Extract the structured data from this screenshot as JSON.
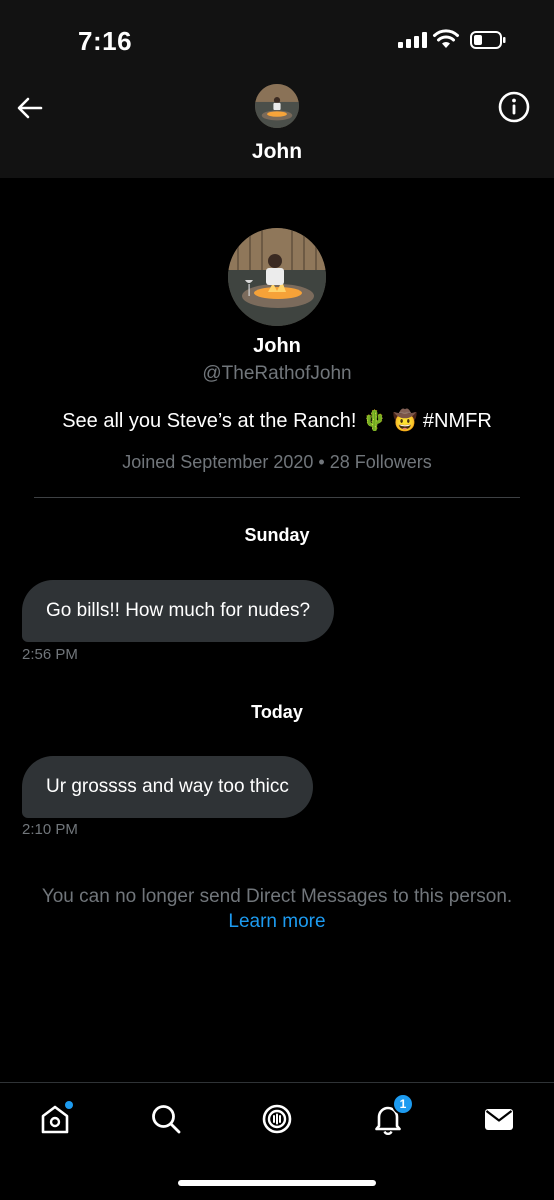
{
  "status_bar": {
    "time": "7:16"
  },
  "header": {
    "name": "John"
  },
  "profile": {
    "name": "John",
    "handle": "@TheRathofJohn",
    "bio": "See all you Steve’s at the Ranch! 🌵 🤠 #NMFR",
    "meta": "Joined September 2020 • 28 Followers"
  },
  "conversation": [
    {
      "day": "Sunday",
      "message": "Go bills!! How much for nudes?",
      "time": "2:56 PM"
    },
    {
      "day": "Today",
      "message": "Ur grossss and way too thicc",
      "time": "2:10 PM"
    }
  ],
  "notice": {
    "text": "You can no longer send Direct Messages to this person.",
    "link": "Learn more"
  },
  "tabbar": {
    "items": [
      "home-icon",
      "search-icon",
      "spaces-icon",
      "notifications-icon",
      "messages-icon"
    ],
    "notifications_badge": "1"
  },
  "colors": {
    "accent": "#1d9bf0",
    "bubble": "#2f3336",
    "muted": "#71767b"
  }
}
